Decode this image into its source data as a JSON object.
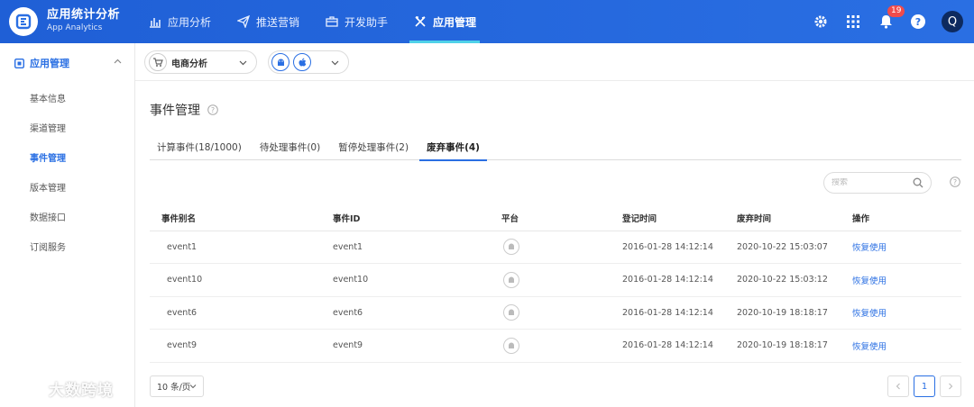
{
  "brand": {
    "title": "应用统计分析",
    "subtitle": "App Analytics"
  },
  "nav": [
    {
      "label": "应用分析",
      "icon": "bar-chart-icon"
    },
    {
      "label": "推送营销",
      "icon": "paper-plane-icon"
    },
    {
      "label": "开发助手",
      "icon": "toolbox-icon"
    },
    {
      "label": "应用管理",
      "icon": "tools-icon",
      "active": true
    }
  ],
  "header": {
    "notification_count": "19",
    "avatar_letter": "Q"
  },
  "sidebar": {
    "section": "应用管理",
    "items": [
      {
        "label": "基本信息"
      },
      {
        "label": "渠道管理"
      },
      {
        "label": "事件管理",
        "active": true
      },
      {
        "label": "版本管理"
      },
      {
        "label": "数据接口"
      },
      {
        "label": "订阅服务"
      }
    ]
  },
  "subbar": {
    "app_name": "电商分析"
  },
  "page": {
    "title": "事件管理"
  },
  "tabs": [
    {
      "label": "计算事件(18/1000)"
    },
    {
      "label": "待处理事件(0)"
    },
    {
      "label": "暂停处理事件(2)"
    },
    {
      "label": "废弃事件(4)",
      "active": true
    }
  ],
  "search": {
    "placeholder": "搜索"
  },
  "table": {
    "headers": [
      "事件别名",
      "事件ID",
      "平台",
      "登记时间",
      "废弃时间",
      "操作"
    ],
    "rows": [
      {
        "alias": "event1",
        "id": "event1",
        "registered": "2016-01-28 14:12:14",
        "discarded": "2020-10-22 15:03:07",
        "action": "恢复使用"
      },
      {
        "alias": "event10",
        "id": "event10",
        "registered": "2016-01-28 14:12:14",
        "discarded": "2020-10-22 15:03:12",
        "action": "恢复使用"
      },
      {
        "alias": "event6",
        "id": "event6",
        "registered": "2016-01-28 14:12:14",
        "discarded": "2020-10-19 18:18:17",
        "action": "恢复使用"
      },
      {
        "alias": "event9",
        "id": "event9",
        "registered": "2016-01-28 14:12:14",
        "discarded": "2020-10-19 18:18:17",
        "action": "恢复使用"
      }
    ]
  },
  "pagination": {
    "page_size": "10 条/页",
    "current_page": "1"
  },
  "watermark": {
    "text": "大数跨境"
  },
  "colors": {
    "primary": "#2a6fe3",
    "header_bg": "#1f5fd6",
    "badge": "#f04b4b",
    "tab_indicator": "#4fd1e8"
  }
}
